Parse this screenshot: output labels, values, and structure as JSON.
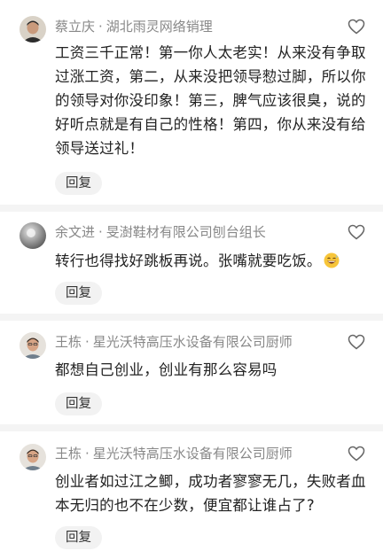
{
  "comments": [
    {
      "author": "蔡立庆",
      "separator": "·",
      "title": "湖北雨灵网络销理",
      "text": "工资三千正常！第一你人太老实！从来没有争取过涨工资，第二，从来没把领导愸过脚，所以你的领导对你没印象！第三，脾气应该很臭，说的好听点就是有自己的性格！第四，你从来没有给领导送过礼！",
      "reply_label": "回复"
    },
    {
      "author": "余文进",
      "separator": "·",
      "title": "旻澍鞋材有限公司刨台组长",
      "text": "转行也得找好跳板再说。张嘴就要吃饭。",
      "emoji": "grinning-sweat-emoji",
      "reply_label": "回复"
    },
    {
      "author": "王栋",
      "separator": "·",
      "title": "星光沃特高压水设备有限公司厨师",
      "text": "都想自己创业，创业有那么容易吗",
      "reply_label": "回复"
    },
    {
      "author": "王栋",
      "separator": "·",
      "title": "星光沃特高压水设备有限公司厨师",
      "text": "创业者如过江之鲫，成功者寥寥无几，失败者血本无归的也不在少数，便宜都让谁占了?",
      "reply_label": "回复"
    }
  ],
  "icons": {
    "like": "heart-outline-icon"
  },
  "colors": {
    "name_text": "#888888",
    "body_text": "#222222",
    "reply_bg": "#f2f2f2",
    "divider": "#f4f4f4"
  }
}
